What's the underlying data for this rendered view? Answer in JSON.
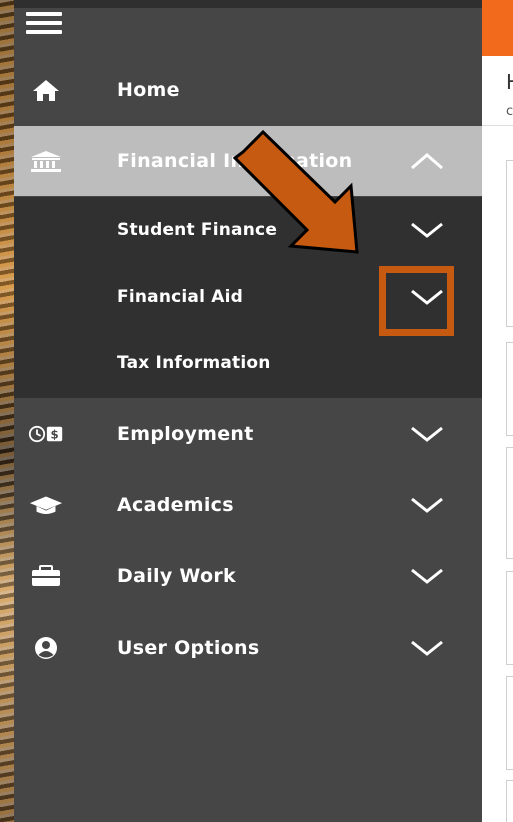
{
  "sidebar": {
    "items": [
      {
        "label": "Home",
        "icon": "home-icon"
      },
      {
        "label": "Financial Information",
        "icon": "bank-icon",
        "expanded": true,
        "children": [
          {
            "label": "Student Finance"
          },
          {
            "label": "Financial Aid"
          },
          {
            "label": "Tax Information"
          }
        ]
      },
      {
        "label": "Employment",
        "icon": "clock-dollar-icon"
      },
      {
        "label": "Academics",
        "icon": "graduation-cap-icon"
      },
      {
        "label": "Daily Work",
        "icon": "briefcase-icon"
      },
      {
        "label": "User Options",
        "icon": "user-circle-icon"
      }
    ]
  },
  "content": {
    "heading_partial": "H",
    "subheading_partial": "c"
  },
  "colors": {
    "sidebar_bg": "#464646",
    "submenu_bg": "#303030",
    "expanded_bg": "#bdbdbd",
    "accent": "#f26a1b",
    "annotation": "#c65a10"
  }
}
